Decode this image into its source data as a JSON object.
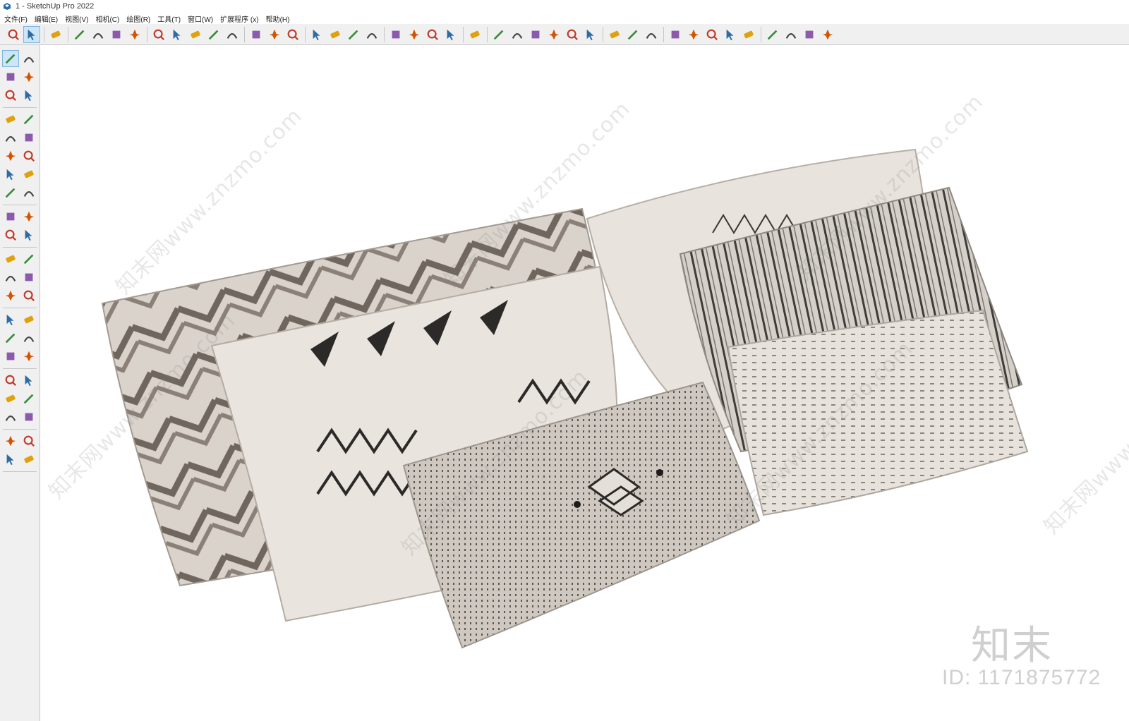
{
  "window": {
    "title": "1 - SketchUp Pro 2022"
  },
  "menu": [
    "文件(F)",
    "编辑(E)",
    "视图(V)",
    "相机(C)",
    "绘图(R)",
    "工具(T)",
    "窗口(W)",
    "扩展程序 (x)",
    "帮助(H)"
  ],
  "toolbar": {
    "icons": [
      "search-icon",
      "select-icon",
      "eraser-icon",
      "pencil-icon",
      "arc-icon",
      "rectangle-icon",
      "pushpull-icon",
      "followme-icon",
      "move-icon",
      "rotate-icon",
      "scale-icon",
      "tape-icon",
      "text-icon",
      "paint-icon",
      "orbit-icon",
      "pan-icon",
      "zoom-icon",
      "zoom-extents-icon",
      "layout-icon",
      "section-icon",
      "layers-icon",
      "section-fill-icon",
      "person-icon",
      "component-icon",
      "door-icon",
      "home-icon",
      "box-icon",
      "house-outline-icon",
      "garage-icon",
      "addlocation-icon",
      "sandbox-icon",
      "scene-icon",
      "circle-plus-icon",
      "shield-icon",
      "bars-icon",
      "checker-icon",
      "cloud-icon",
      "gear-icon",
      "window-icon",
      "info-icon",
      "cart-icon",
      "account-icon"
    ]
  },
  "left_toolbar": {
    "icons": [
      "select-icon",
      "orbit-icon",
      "paint-icon",
      "eraser-icon",
      "component-icon",
      "tag-icon",
      "pencil-icon",
      "freehand-icon",
      "rectangle-icon",
      "rotated-rect-icon",
      "circle-icon",
      "polygon-icon",
      "arc-icon",
      "pie-icon",
      "arc2-icon",
      "arc3-icon",
      "move-icon",
      "pushpull-icon",
      "rotate-icon",
      "followme-icon",
      "scale-icon",
      "offset-icon",
      "tape-icon",
      "dimension-icon",
      "protractor-icon",
      "text-icon",
      "axes-icon",
      "3dtext-icon",
      "orbit2-icon",
      "pan-icon",
      "zoom-icon",
      "zoom-window-icon",
      "zoom-extents-icon",
      "previous-icon",
      "walk-icon",
      "eye-icon",
      "footprint-icon",
      "position-camera-icon",
      "section-plane-icon",
      "section-cut-icon",
      "section-display-icon",
      "section-fill-icon"
    ]
  },
  "watermark": {
    "text": "知末网www.znzmo.com"
  },
  "brand": {
    "logo": "知末",
    "id": "ID: 1171875772"
  },
  "colors": {
    "accent": "#cde6f7",
    "pillow_base": "#e6e1dc",
    "pattern_dark": "#3a3836"
  }
}
